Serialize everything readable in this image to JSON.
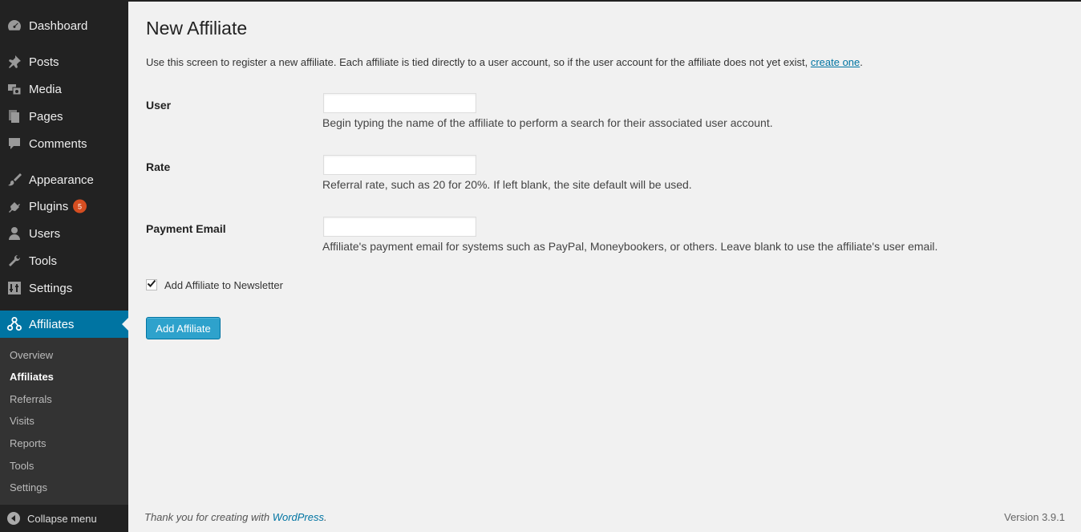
{
  "sidebar": {
    "items": [
      {
        "label": "Dashboard",
        "icon": "dashboard-icon"
      },
      {
        "label": "Posts",
        "icon": "pin-icon"
      },
      {
        "label": "Media",
        "icon": "media-icon"
      },
      {
        "label": "Pages",
        "icon": "pages-icon"
      },
      {
        "label": "Comments",
        "icon": "comment-icon"
      },
      {
        "label": "Appearance",
        "icon": "brush-icon"
      },
      {
        "label": "Plugins",
        "icon": "plugin-icon",
        "badge": "5"
      },
      {
        "label": "Users",
        "icon": "user-icon"
      },
      {
        "label": "Tools",
        "icon": "wrench-icon"
      },
      {
        "label": "Settings",
        "icon": "settings-icon"
      },
      {
        "label": "Affiliates",
        "icon": "affiliates-icon",
        "active": true
      }
    ],
    "submenu": [
      "Overview",
      "Affiliates",
      "Referrals",
      "Visits",
      "Reports",
      "Tools",
      "Settings"
    ],
    "submenu_current": "Affiliates",
    "collapse_label": "Collapse menu"
  },
  "page": {
    "title": "New Affiliate",
    "intro_text": "Use this screen to register a new affiliate. Each affiliate is tied directly to a user account, so if the user account for the affiliate does not yet exist, ",
    "intro_link": "create one",
    "intro_end": ".",
    "fields": [
      {
        "label": "User",
        "value": "",
        "description": "Begin typing the name of the affiliate to perform a search for their associated user account."
      },
      {
        "label": "Rate",
        "value": "",
        "description": "Referral rate, such as 20 for 20%. If left blank, the site default will be used."
      },
      {
        "label": "Payment Email",
        "value": "",
        "description": "Affiliate's payment email for systems such as PayPal, Moneybookers, or others. Leave blank to use the affiliate's user email."
      }
    ],
    "newsletter_label": "Add Affiliate to Newsletter",
    "newsletter_checked": true,
    "submit_label": "Add Affiliate"
  },
  "footer": {
    "thanks_text": "Thank you for creating with ",
    "thanks_link": "WordPress",
    "thanks_end": ".",
    "version": "Version 3.9.1"
  },
  "colors": {
    "sidebar_bg": "#222222",
    "submenu_bg": "#333333",
    "active_bg": "#0074a2",
    "button_bg": "#2ea2cc",
    "badge_bg": "#d54e21",
    "page_bg": "#f1f1f1"
  }
}
